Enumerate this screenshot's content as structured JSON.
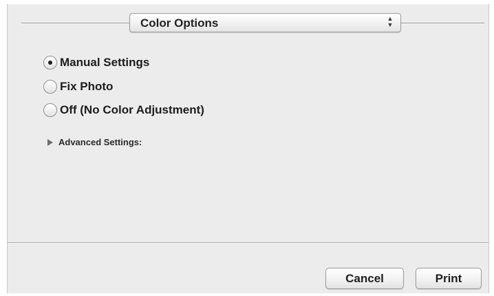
{
  "popup": {
    "selected": "Color Options"
  },
  "color_mode": {
    "options": [
      {
        "label": "Manual Settings",
        "checked": true
      },
      {
        "label": "Fix Photo",
        "checked": false
      },
      {
        "label": "Off (No Color Adjustment)",
        "checked": false
      }
    ]
  },
  "advanced": {
    "label": "Advanced Settings:",
    "expanded": false
  },
  "footer": {
    "cancel_label": "Cancel",
    "print_label": "Print"
  }
}
